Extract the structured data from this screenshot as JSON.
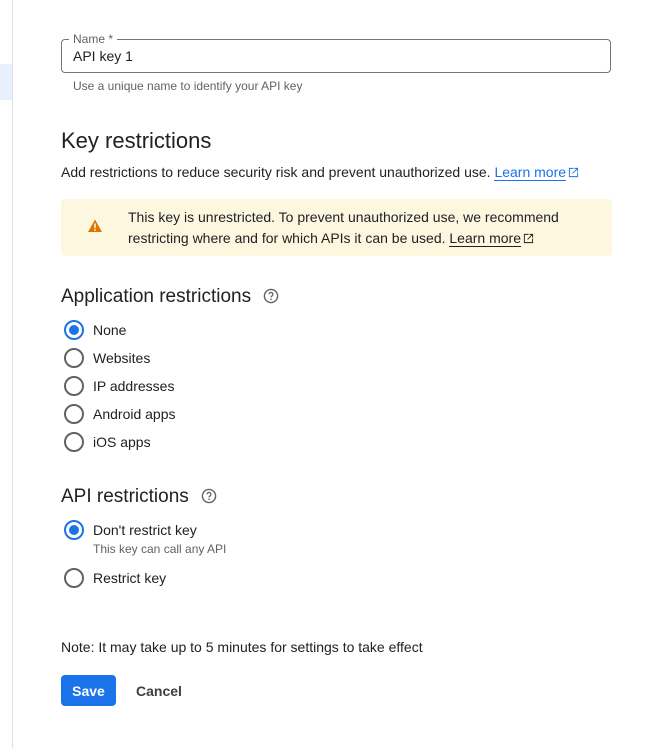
{
  "name_field": {
    "label": "Name *",
    "value": "API key 1",
    "hint": "Use a unique name to identify your API key"
  },
  "key_restrictions": {
    "title": "Key restrictions",
    "description": "Add restrictions to reduce security risk and prevent unauthorized use.",
    "learn_more": "Learn more"
  },
  "warning": {
    "text": "This key is unrestricted. To prevent unauthorized use, we recommend restricting where and for which APIs it can be used.",
    "learn_more": "Learn more",
    "icon": "warning-icon",
    "color": "#e37400"
  },
  "application_restrictions": {
    "title": "Application restrictions",
    "options": [
      {
        "label": "None",
        "checked": true
      },
      {
        "label": "Websites",
        "checked": false
      },
      {
        "label": "IP addresses",
        "checked": false
      },
      {
        "label": "Android apps",
        "checked": false
      },
      {
        "label": "iOS apps",
        "checked": false
      }
    ]
  },
  "api_restrictions": {
    "title": "API restrictions",
    "options": [
      {
        "label": "Don't restrict key",
        "sublabel": "This key can call any API",
        "checked": true
      },
      {
        "label": "Restrict key",
        "checked": false
      }
    ]
  },
  "footer": {
    "note": "Note: It may take up to 5 minutes for settings to take effect",
    "save_label": "Save",
    "cancel_label": "Cancel"
  },
  "colors": {
    "accent": "#1a73e8",
    "warning_bg": "#fef7e0"
  }
}
